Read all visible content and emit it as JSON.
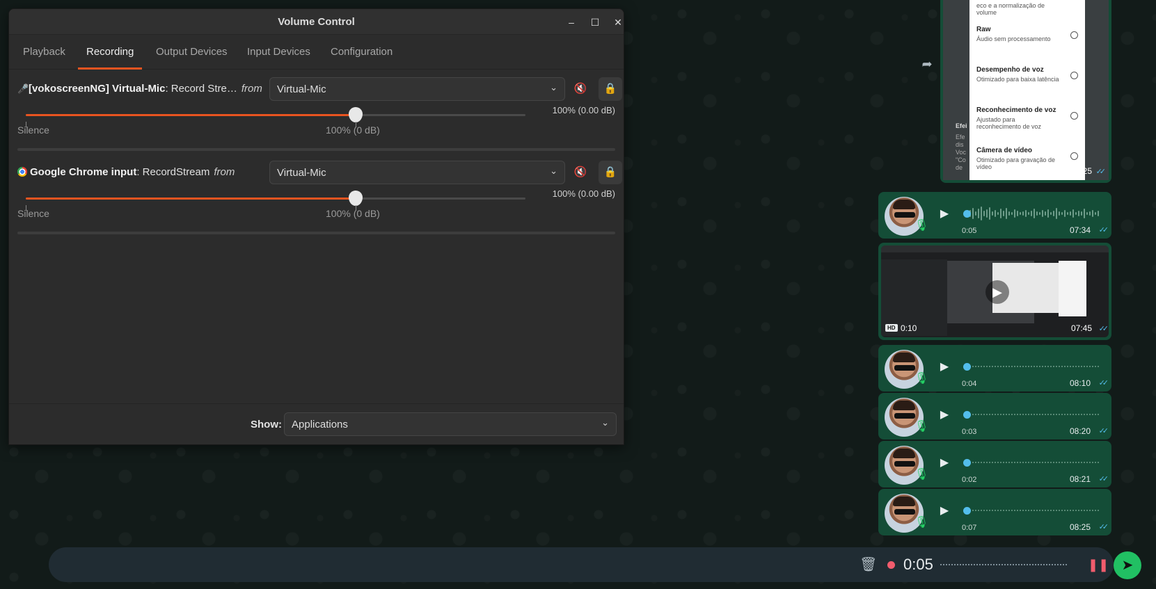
{
  "volume_control": {
    "title": "Volume Control",
    "tabs": [
      {
        "label": "Playback",
        "active": false
      },
      {
        "label": "Recording",
        "active": true
      },
      {
        "label": "Output Devices",
        "active": false
      },
      {
        "label": "Input Devices",
        "active": false
      },
      {
        "label": "Configuration",
        "active": false
      }
    ],
    "streams": [
      {
        "app_name": "[vokoscreenNG] Virtual-Mic",
        "stream_name": ": Record Stre…",
        "from_label": "from",
        "device": "Virtual-Mic",
        "volume_readout": "100% (0.00 dB)",
        "volume_fraction": 0.66,
        "silence_label": "Silence",
        "hundred_label": "100% (0 dB)"
      },
      {
        "app_name": "Google Chrome input",
        "stream_name": ": RecordStream",
        "from_label": "from",
        "device": "Virtual-Mic",
        "volume_readout": "100% (0.00 dB)",
        "volume_fraction": 0.66,
        "silence_label": "Silence",
        "hundred_label": "100% (0 dB)"
      }
    ],
    "show_label": "Show:",
    "show_value": "Applications"
  },
  "whatsapp": {
    "screenshot_options": [
      {
        "title": "",
        "desc": "eco e a normalização de volume"
      },
      {
        "title": "Raw",
        "desc": "Áudio sem processamento"
      },
      {
        "title": "Desempenho de voz",
        "desc": "Otimizado para baixa latência"
      },
      {
        "title": "Reconhecimento de voz",
        "desc": "Ajustado para reconhecimento de voz"
      },
      {
        "title": "Câmera de vídeo",
        "desc": "Otimizado para gravação de vídeo"
      }
    ],
    "screenshot_side_text": "Efei",
    "screenshot_side_sub": "Efe dis Voc \"Co de",
    "screenshot_time": "07:25",
    "voice_messages": [
      {
        "duration": "0:05",
        "time": "07:34",
        "has_wave": true
      },
      {
        "duration": "0:04",
        "time": "08:10",
        "has_wave": false
      },
      {
        "duration": "0:03",
        "time": "08:20",
        "has_wave": false
      },
      {
        "duration": "0:02",
        "time": "08:21",
        "has_wave": false
      },
      {
        "duration": "0:07",
        "time": "08:25",
        "has_wave": false
      }
    ],
    "video": {
      "hd": "HD",
      "duration": "0:10",
      "time": "07:45"
    },
    "recording": {
      "elapsed": "0:05"
    },
    "colors": {
      "bubble": "#144d37",
      "accent": "#21c063",
      "tick": "#53bdeb",
      "record": "#f15c6d"
    }
  }
}
